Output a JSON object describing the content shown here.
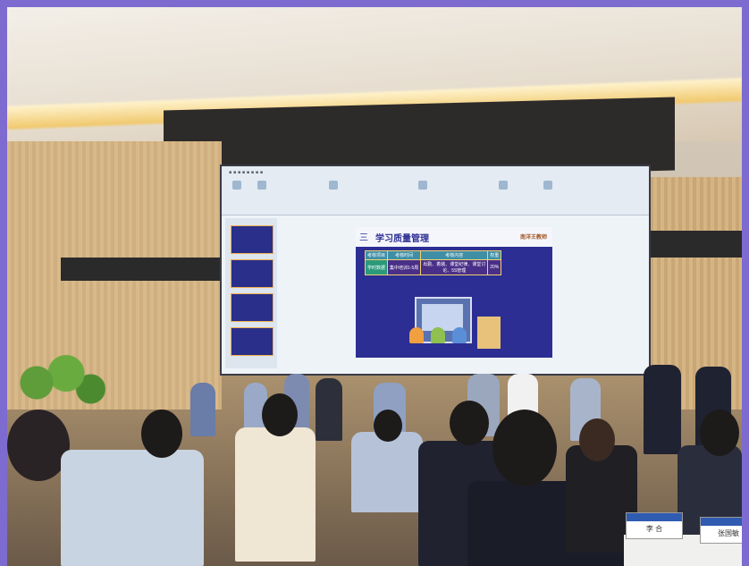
{
  "slide": {
    "number": "三",
    "title": "学习质量管理",
    "logo_text": "南洋王教师",
    "table": {
      "headers": [
        "考核项目",
        "考核时间",
        "考核内容",
        "权重"
      ],
      "rows": [
        [
          "学时数据",
          "集中培训1-5周",
          "出勤、着装、课堂纪律、课堂讨论、5S管理",
          "20%"
        ]
      ]
    }
  },
  "nameplates": [
    "李 合",
    "张国敏"
  ],
  "colors": {
    "frame": "#7d6bd0",
    "slide_bg": "#2c2e93",
    "table_border": "#f4d070"
  }
}
